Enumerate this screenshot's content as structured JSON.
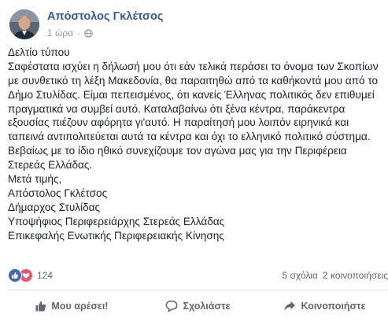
{
  "post": {
    "author": "Απόστολος Γκλέτσος",
    "time": "1 ώρα",
    "separator": "·",
    "privacy_icon": "globe-icon",
    "body_lines": [
      "Δελτίο τύπου",
      "Σαφέστατα ισχύει η δήλωσή μου ότι εάν τελικά περάσει το όνομα των Σκοπίων",
      "με συνθετικό τη λέξη Μακεδονία, θα παραιτηθώ από τα καθήκοντά μου από το",
      "Δήμο Στυλίδας. Είμαι πεπεισμένος, ότι κανείς Έλληνας πολιτικός δεν επιθυμεί",
      "πραγματικά να συμβεί αυτό. Καταλαβαίνω ότι ξένα κέντρα, παράκεντρα",
      "εξουσίας πιέζουν αφόρητα γι'αυτό. Η παραίτησή μου λοιπόν ειρηνικά και",
      "ταπεινά αντιπολιτεύεται αυτά τα κέντρα και όχι το ελληνικό πολιτικό σύστημα.",
      "Βεβαίως με το ίδιο ηθικό συνεχίζουμε τον αγώνα μας για την Περιφέρεια",
      "Στερεάς Ελλάδας.",
      "Μετά τιμής,",
      "Απόστολος Γκλέτσος",
      "Δήμαρχος Στυλίδας",
      "Υποψήφιος Περιφερειάρχης Στερεάς Ελλάδας",
      "Επικεφαλής Ενωτικής Περιφερειακής Κίνησης"
    ]
  },
  "reactions": {
    "count": "124",
    "icons": [
      "like-icon",
      "love-icon"
    ],
    "like_color": "#4267b2",
    "love_color": "#f0506e"
  },
  "stats": {
    "comments": "5 σχόλια",
    "shares": "2 κοινοποιήσεις"
  },
  "actions": {
    "like": "Μου αρέσει!",
    "comment": "Σχολιάστε",
    "share": "Κοινοποιήστε"
  },
  "colors": {
    "author_link": "#365899",
    "meta_text": "#90949c",
    "action_text": "#606770"
  }
}
